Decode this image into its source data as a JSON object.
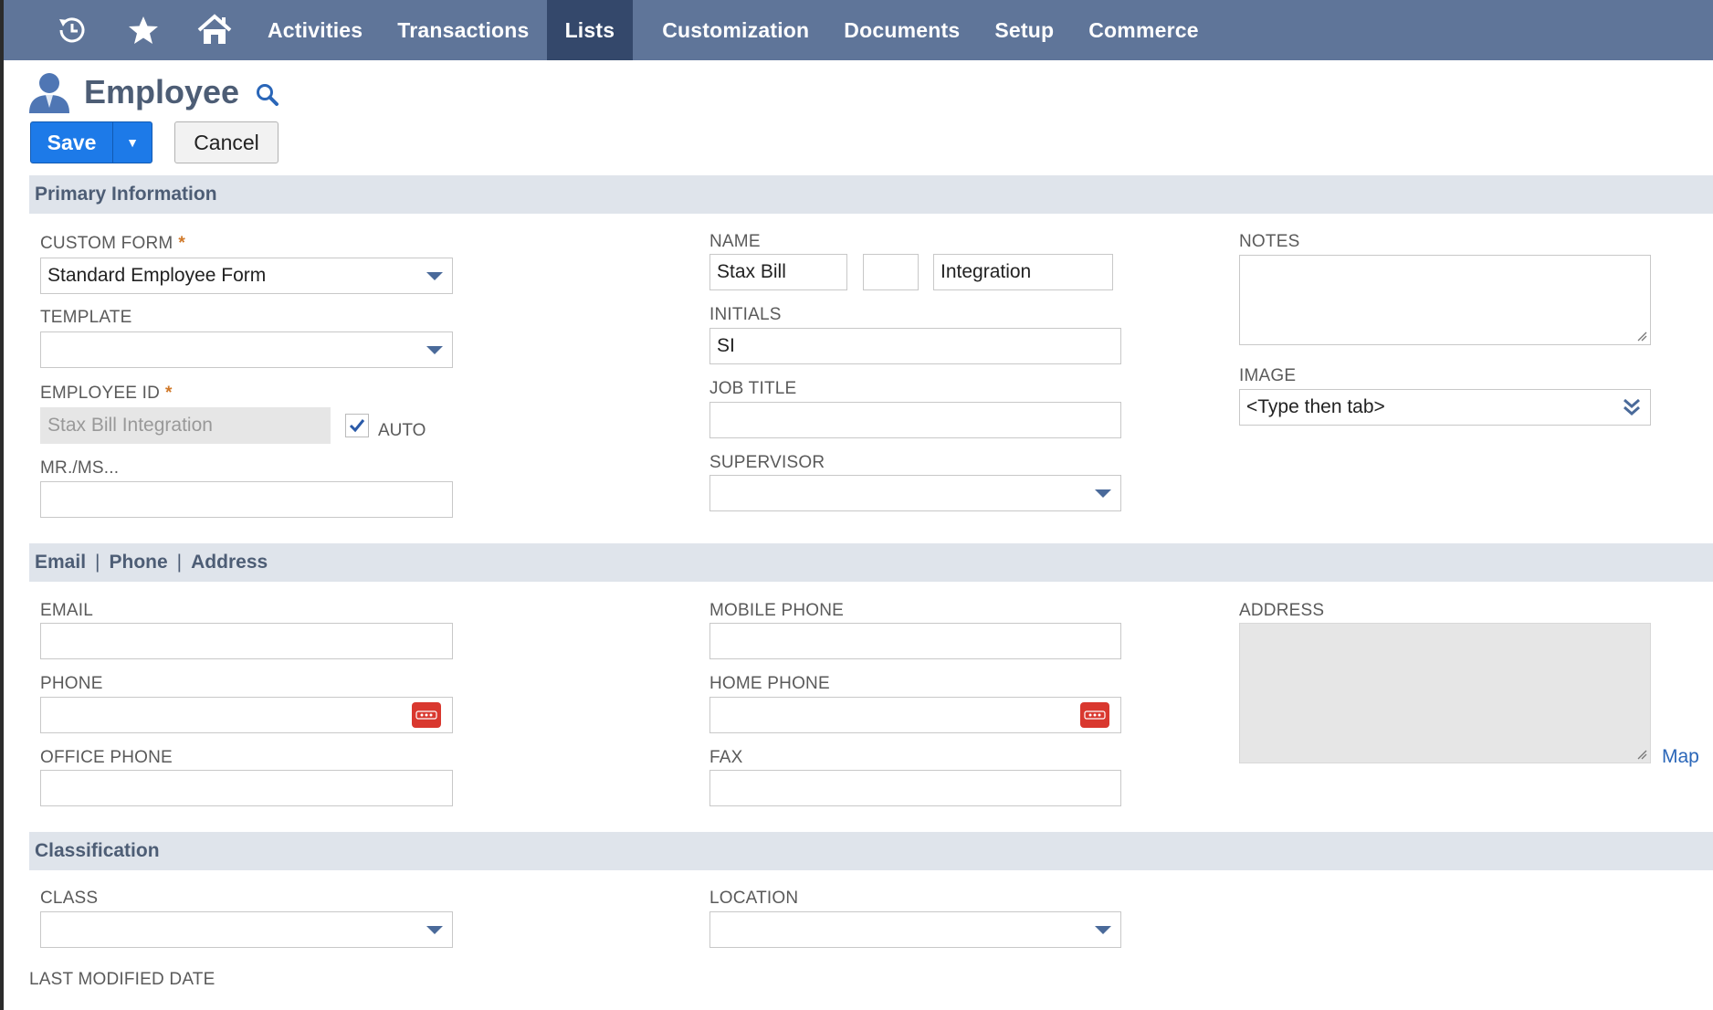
{
  "nav": {
    "icons": [
      "recent-icon",
      "star-icon",
      "home-icon"
    ],
    "items": [
      {
        "label": "Activities"
      },
      {
        "label": "Transactions"
      },
      {
        "label": "Lists",
        "active": true
      },
      {
        "label": "Customization"
      },
      {
        "label": "Documents"
      },
      {
        "label": "Setup"
      },
      {
        "label": "Commerce"
      }
    ]
  },
  "header": {
    "title": "Employee",
    "icon": "person-icon",
    "search_icon": "search-icon"
  },
  "toolbar": {
    "save_label": "Save",
    "save_menu_arrow": "▼",
    "cancel_label": "Cancel"
  },
  "sections": {
    "primary": "Primary Information",
    "contact": [
      "Email",
      "Phone",
      "Address"
    ],
    "contact_sep": "|",
    "classification": "Classification"
  },
  "required_marker": "*",
  "fields": {
    "custom_form": {
      "label": "CUSTOM FORM",
      "value": "Standard Employee Form",
      "required": true
    },
    "template": {
      "label": "TEMPLATE",
      "value": ""
    },
    "employee_id": {
      "label": "EMPLOYEE ID",
      "value": "Stax Bill Integration",
      "required": true,
      "auto_label": "AUTO",
      "auto_checked": true
    },
    "mr_ms": {
      "label": "MR./MS...",
      "value": ""
    },
    "name": {
      "label": "NAME",
      "first": "Stax Bill",
      "middle": "",
      "last": "Integration"
    },
    "initials": {
      "label": "INITIALS",
      "value": "SI"
    },
    "job_title": {
      "label": "JOB TITLE",
      "value": ""
    },
    "supervisor": {
      "label": "SUPERVISOR",
      "value": ""
    },
    "notes": {
      "label": "NOTES",
      "value": ""
    },
    "image": {
      "label": "IMAGE",
      "value": "<Type then tab>"
    },
    "email": {
      "label": "EMAIL",
      "value": ""
    },
    "phone": {
      "label": "PHONE",
      "value": ""
    },
    "office_phone": {
      "label": "OFFICE PHONE",
      "value": ""
    },
    "mobile_phone": {
      "label": "MOBILE PHONE",
      "value": ""
    },
    "home_phone": {
      "label": "HOME PHONE",
      "value": ""
    },
    "fax": {
      "label": "FAX",
      "value": ""
    },
    "address": {
      "label": "ADDRESS",
      "value": "",
      "map_link": "Map"
    },
    "class": {
      "label": "CLASS",
      "value": ""
    },
    "location": {
      "label": "LOCATION",
      "value": ""
    },
    "last_modified": {
      "label": "LAST MODIFIED DATE"
    }
  },
  "colors": {
    "nav_bg": "#5f7599",
    "nav_active": "#34486b",
    "section_bg": "#dfe4eb",
    "primary_button": "#1d7ae8",
    "phone_button": "#d9382f",
    "required": "#d07828"
  }
}
